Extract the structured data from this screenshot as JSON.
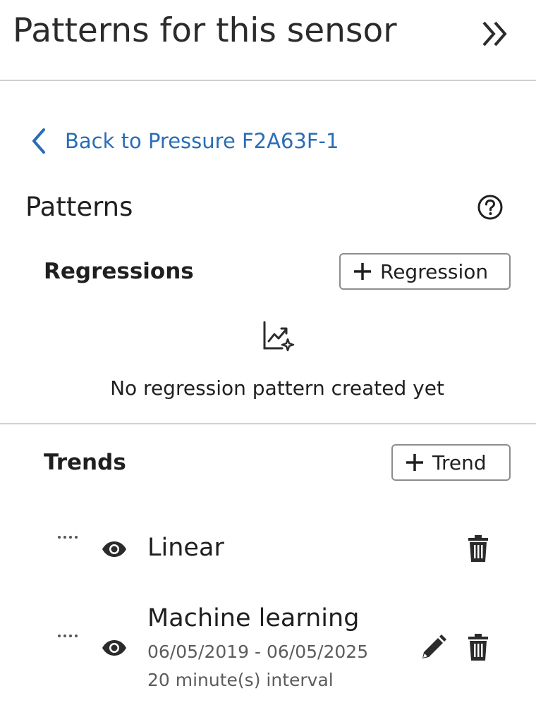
{
  "header": {
    "title": "Patterns for this sensor",
    "collapse_icon": "double-chevron-right-icon"
  },
  "back_link": {
    "label": "Back to Pressure F2A63F-1",
    "icon": "chevron-left-icon",
    "color": "#2a6db5"
  },
  "patterns": {
    "title": "Patterns",
    "help_icon": "question-circle-icon"
  },
  "regressions": {
    "title": "Regressions",
    "add_button_label": "Regression",
    "empty_icon": "chart-sparkle-icon",
    "empty_message": "No regression pattern created yet"
  },
  "trends": {
    "title": "Trends",
    "add_button_label": "Trend",
    "items": [
      {
        "name": "Linear",
        "visible": true,
        "actions": [
          "delete"
        ]
      },
      {
        "name": "Machine learning",
        "date_range": "06/05/2019 - 06/05/2025",
        "interval": "20 minute(s) interval",
        "visible": true,
        "actions": [
          "edit",
          "delete"
        ]
      }
    ]
  },
  "colors": {
    "link": "#2a6db5",
    "text": "#1f1f1f",
    "muted": "#5c5c5c",
    "border": "#8d8d8d",
    "divider": "#cfcfcf"
  }
}
